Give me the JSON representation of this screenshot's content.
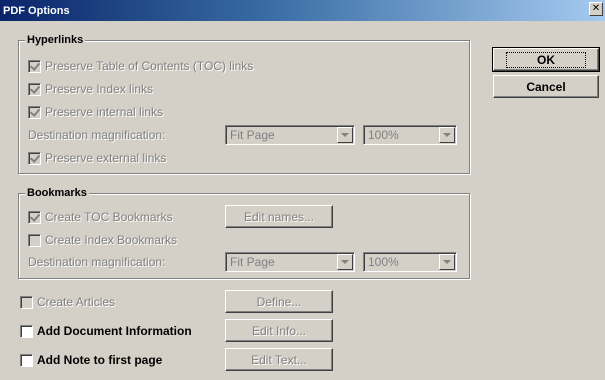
{
  "window": {
    "title": "PDF Options",
    "close_glyph": "✕"
  },
  "hyperlinks": {
    "title": "Hyperlinks",
    "toc_links": "Preserve Table of Contents (TOC) links",
    "index_links": "Preserve Index links",
    "internal_links": "Preserve internal links",
    "dest_label": "Destination magnification:",
    "fit_value": "Fit Page",
    "zoom_value": "100%",
    "external_links": "Preserve external links"
  },
  "bookmarks": {
    "title": "Bookmarks",
    "toc_bookmarks": "Create TOC Bookmarks",
    "edit_names": "Edit names...",
    "index_bookmarks": "Create Index Bookmarks",
    "dest_label": "Destination magnification:",
    "fit_value": "Fit Page",
    "zoom_value": "100%"
  },
  "options": {
    "create_articles": "Create Articles",
    "define": "Define...",
    "add_doc_info": "Add Document Information",
    "edit_info": "Edit Info...",
    "add_note": "Add Note to first page",
    "edit_text": "Edit Text..."
  },
  "buttons": {
    "ok": "OK",
    "cancel": "Cancel"
  },
  "colors": {
    "face": "#d4d0c8",
    "title_start": "#0a246a",
    "title_end": "#a6caf0",
    "disabled_text": "#808080"
  }
}
